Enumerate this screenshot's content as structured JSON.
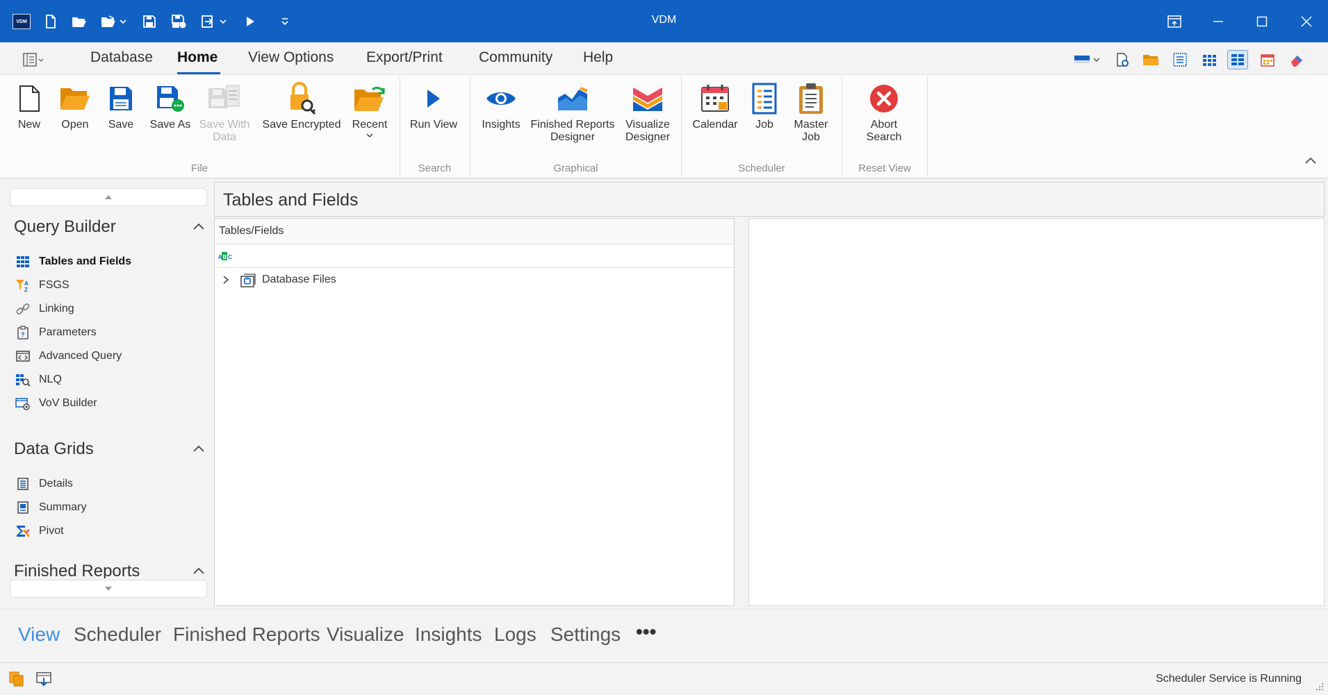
{
  "app": {
    "logo_text": "VDM",
    "title": "VDM"
  },
  "quick_access": [
    {
      "icon": "new-file-icon"
    },
    {
      "icon": "open-folder-icon"
    },
    {
      "icon": "open-dropdown-icon"
    },
    {
      "icon": "save-icon"
    },
    {
      "icon": "save-as-icon"
    },
    {
      "icon": "export-dropdown-icon"
    },
    {
      "icon": "run-icon"
    },
    {
      "icon": "customize-icon"
    }
  ],
  "menu": {
    "tabs": [
      {
        "label": "Database"
      },
      {
        "label": "Home",
        "active": true
      },
      {
        "label": "View Options"
      },
      {
        "label": "Export/Print"
      },
      {
        "label": "Community"
      },
      {
        "label": "Help"
      }
    ]
  },
  "ribbon": {
    "file": {
      "group_label": "File",
      "new": "New",
      "open": "Open",
      "save": "Save",
      "save_as": "Save As",
      "save_with_data_1": "Save With",
      "save_with_data_2": "Data",
      "save_encrypted": "Save Encrypted",
      "recent": "Recent"
    },
    "search": {
      "group_label": "Search",
      "run_view": "Run View"
    },
    "graphical": {
      "group_label": "Graphical",
      "insights": "Insights",
      "frd_1": "Finished Reports",
      "frd_2": "Designer",
      "vis_1": "Visualize",
      "vis_2": "Designer"
    },
    "scheduler": {
      "group_label": "Scheduler",
      "calendar": "Calendar",
      "job": "Job",
      "master_1": "Master",
      "master_2": "Job"
    },
    "reset_view": {
      "group_label": "Reset View",
      "abort_1": "Abort",
      "abort_2": "Search"
    }
  },
  "leftnav": {
    "query_builder": {
      "title": "Query Builder",
      "items": [
        {
          "label": "Tables and Fields",
          "icon": "table-grid-icon",
          "active": true
        },
        {
          "label": "FSGS",
          "icon": "filter-sort-icon"
        },
        {
          "label": "Linking",
          "icon": "link-icon"
        },
        {
          "label": "Parameters",
          "icon": "parameters-icon"
        },
        {
          "label": "Advanced Query",
          "icon": "code-window-icon"
        },
        {
          "label": "NLQ",
          "icon": "nlq-grid-icon"
        },
        {
          "label": "VoV Builder",
          "icon": "vov-builder-icon"
        }
      ]
    },
    "data_grids": {
      "title": "Data Grids",
      "items": [
        {
          "label": "Details",
          "icon": "details-icon"
        },
        {
          "label": "Summary",
          "icon": "summary-icon"
        },
        {
          "label": "Pivot",
          "icon": "pivot-sigma-icon"
        }
      ]
    },
    "finished_reports": {
      "title": "Finished Reports"
    }
  },
  "content": {
    "title": "Tables and Fields",
    "tree": {
      "header": "Tables/Fields",
      "filter_icon": "abc-filter-icon",
      "filter_icon_text": "ABC",
      "root_label": "Database Files"
    }
  },
  "bottomnav": {
    "items": [
      {
        "label": "View",
        "active": true
      },
      {
        "label": "Scheduler"
      },
      {
        "label": "Finished Reports"
      },
      {
        "label": "Visualize"
      },
      {
        "label": "Insights"
      },
      {
        "label": "Logs"
      },
      {
        "label": "Settings"
      }
    ],
    "more": "•••"
  },
  "status": {
    "text": "Scheduler Service is Running"
  },
  "colors": {
    "titlebar": "#1161c2",
    "accent": "#3d8ee0",
    "orange": "#f39c12",
    "abort_red": "#e23b3b"
  }
}
